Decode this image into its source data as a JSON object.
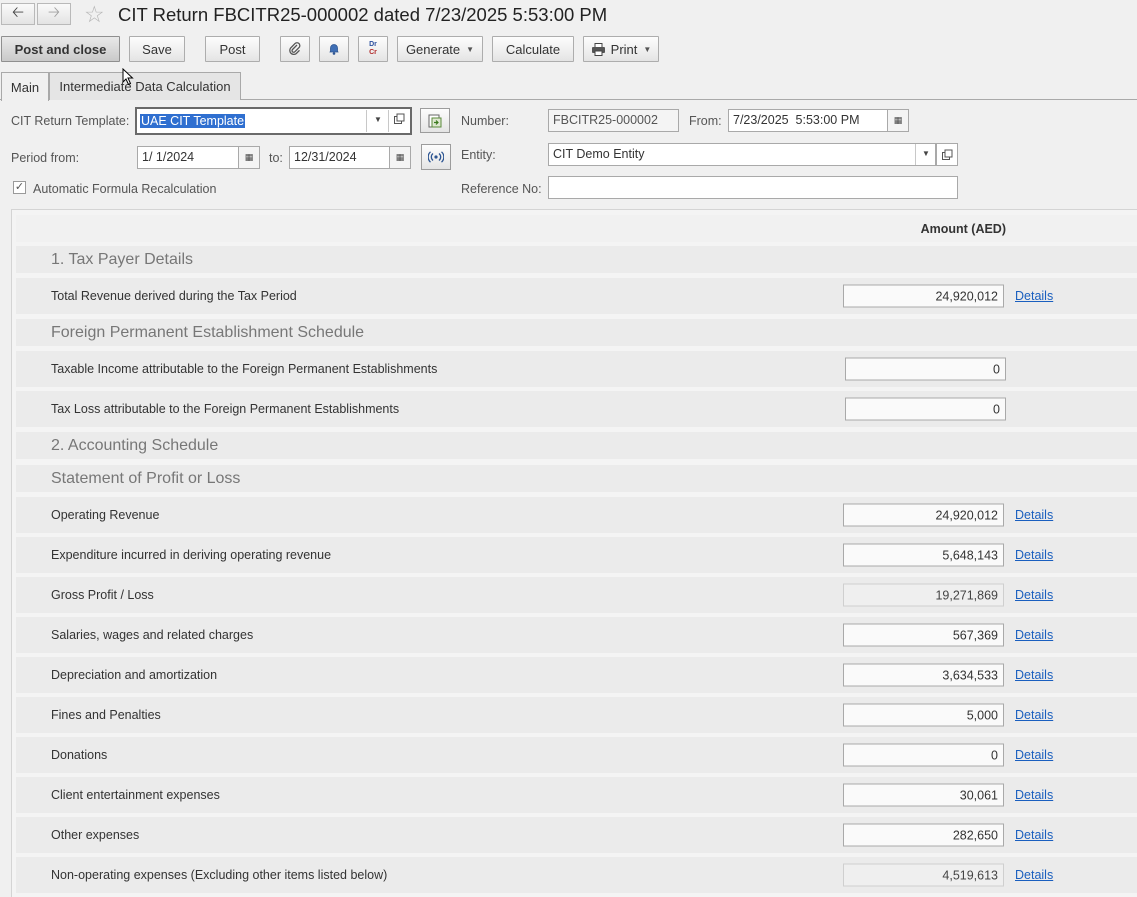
{
  "window": {
    "title": "CIT Return FBCITR25-000002 dated 7/23/2025 5:53:00 PM",
    "back_icon": "arrow-left",
    "forward_icon": "arrow-right",
    "favorite_icon": "star"
  },
  "toolbar": {
    "post_and_close": "Post and close",
    "save": "Save",
    "post": "Post",
    "attach_icon": "paperclip",
    "notify_icon": "bell",
    "drcr_dr": "Dr",
    "drcr_cr": "Cr",
    "generate": "Generate",
    "calculate": "Calculate",
    "print": "Print"
  },
  "tabs": {
    "main": "Main",
    "intermediate": "Intermediate Data Calculation"
  },
  "form": {
    "template_label": "CIT Return Template:",
    "template_value": "UAE CIT Template",
    "number_label": "Number:",
    "number_value": "FBCITR25-000002",
    "from_label": "From:",
    "from_value": "7/23/2025  5:53:00 PM",
    "period_from_label": "Period from:",
    "period_from_value": "1/ 1/2024",
    "to_label": "to:",
    "to_value": "12/31/2024",
    "entity_label": "Entity:",
    "entity_value": "CIT Demo Entity",
    "auto_recalc_label": "Automatic Formula Recalculation",
    "auto_recalc_checked": true,
    "reference_label": "Reference No:",
    "reference_value": ""
  },
  "grid": {
    "amount_header": "Amount (AED)",
    "details_label": "Details",
    "sections": {
      "s1": "1. Tax Payer Details",
      "s2": "Foreign Permanent Establishment Schedule",
      "s3": "2. Accounting Schedule",
      "s4": "Statement of Profit or Loss"
    },
    "rows": {
      "r1": {
        "label": "Total Revenue derived during the Tax Period",
        "amount": "24,920,012"
      },
      "r2": {
        "label": "Taxable Income attributable to the Foreign Permanent Establishments",
        "amount": "0"
      },
      "r3": {
        "label": "Tax Loss attributable to the Foreign Permanent Establishments",
        "amount": "0"
      },
      "r4": {
        "label": "Operating Revenue",
        "amount": "24,920,012"
      },
      "r5": {
        "label": "Expenditure incurred in deriving operating revenue",
        "amount": "5,648,143"
      },
      "r6": {
        "label": "Gross Profit / Loss",
        "amount": "19,271,869"
      },
      "r7": {
        "label": "Salaries, wages and related charges",
        "amount": "567,369"
      },
      "r8": {
        "label": "Depreciation and amortization",
        "amount": "3,634,533"
      },
      "r9": {
        "label": "Fines and Penalties",
        "amount": "5,000"
      },
      "r10": {
        "label": "Donations",
        "amount": "0"
      },
      "r11": {
        "label": "Client entertainment expenses",
        "amount": "30,061"
      },
      "r12": {
        "label": "Other expenses",
        "amount": "282,650"
      },
      "r13": {
        "label": "Non-operating expenses (Excluding other items listed below)",
        "amount": "4,519,613"
      }
    }
  }
}
